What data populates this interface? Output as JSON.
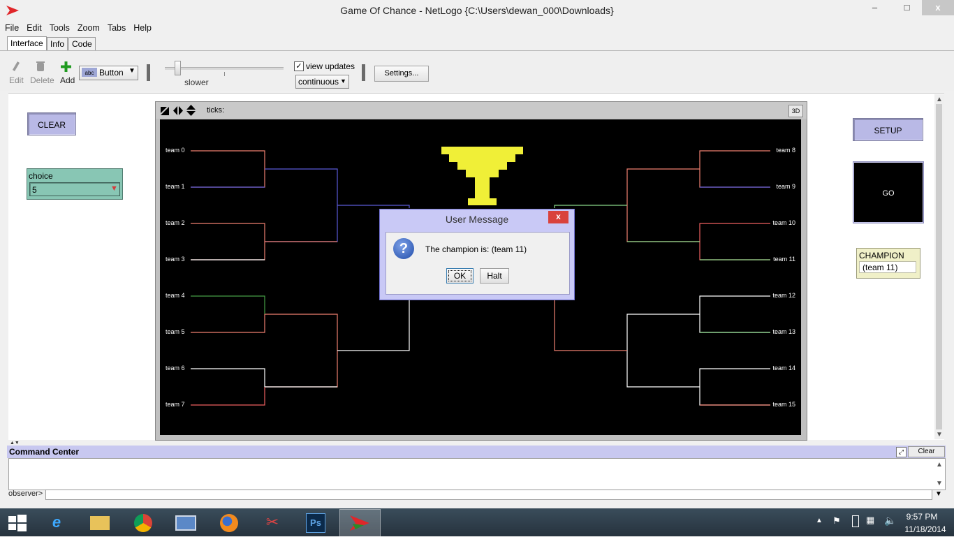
{
  "window": {
    "title": "Game Of Chance - NetLogo {C:\\Users\\dewan_000\\Downloads}",
    "minimize": "–",
    "maximize": "□",
    "close": "x"
  },
  "menu": [
    "File",
    "Edit",
    "Tools",
    "Zoom",
    "Tabs",
    "Help"
  ],
  "tabs": [
    "Interface",
    "Info",
    "Code"
  ],
  "toolbar": {
    "edit": "Edit",
    "delete": "Delete",
    "add": "Add",
    "widget_type": "Button",
    "widget_type_icon": "abc",
    "speed_label": "slower",
    "view_updates": "view updates",
    "view_updates_checked": true,
    "update_mode": "continuous",
    "settings": "Settings..."
  },
  "widgets": {
    "clear_button": "CLEAR",
    "chooser": {
      "label": "choice",
      "value": "5"
    },
    "setup_button": "SETUP",
    "go_button": "GO",
    "monitor": {
      "label": "CHAMPION",
      "value": "(team 11)"
    }
  },
  "view": {
    "ticks_label": "ticks:",
    "three_d": "3D",
    "left_teams": [
      "team 0",
      "team 1",
      "team 2",
      "team 3",
      "team 4",
      "team 5",
      "team 6",
      "team 7"
    ],
    "right_teams": [
      "team 8",
      "team 9",
      "team 10",
      "team 11",
      "team 12",
      "team 13",
      "team 14",
      "team 15"
    ]
  },
  "dialog": {
    "title": "User Message",
    "message": "The champion is: (team 11)",
    "icon": "?",
    "ok": "OK",
    "halt": "Halt",
    "close": "x"
  },
  "command_center": {
    "title": "Command Center",
    "clear": "Clear",
    "prompt": "observer>"
  },
  "taskbar": {
    "time": "9:57 PM",
    "date": "11/18/2014"
  },
  "colors": {
    "button_bg": "#b9b9e6",
    "chooser_bg": "#88c6b4",
    "monitor_bg": "#f0f0c8",
    "trophy": "#f0ef37",
    "dialog_frame": "#c9c9f6"
  }
}
